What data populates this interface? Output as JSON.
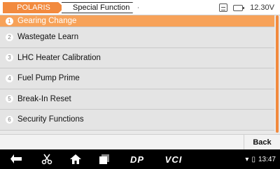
{
  "breadcrumb": {
    "brand": "POLARIS",
    "function": "Special Function"
  },
  "status": {
    "voltage": "12.30V",
    "print_icon": "print-icon",
    "battery_icon": "battery-icon"
  },
  "items": [
    {
      "num": "1",
      "label": "Gearing Change"
    },
    {
      "num": "2",
      "label": "Wastegate Learn"
    },
    {
      "num": "3",
      "label": "LHC Heater Calibration"
    },
    {
      "num": "4",
      "label": "Fuel Pump Prime"
    },
    {
      "num": "5",
      "label": "Break-In Reset"
    },
    {
      "num": "6",
      "label": "Security Functions"
    }
  ],
  "footer": {
    "back_label": "Back"
  },
  "navbar": {
    "dp_label": "DP",
    "vci_label": "VCI",
    "time": "13:47"
  },
  "colors": {
    "accent": "#f28a3e",
    "selected_row": "#f7a259"
  }
}
